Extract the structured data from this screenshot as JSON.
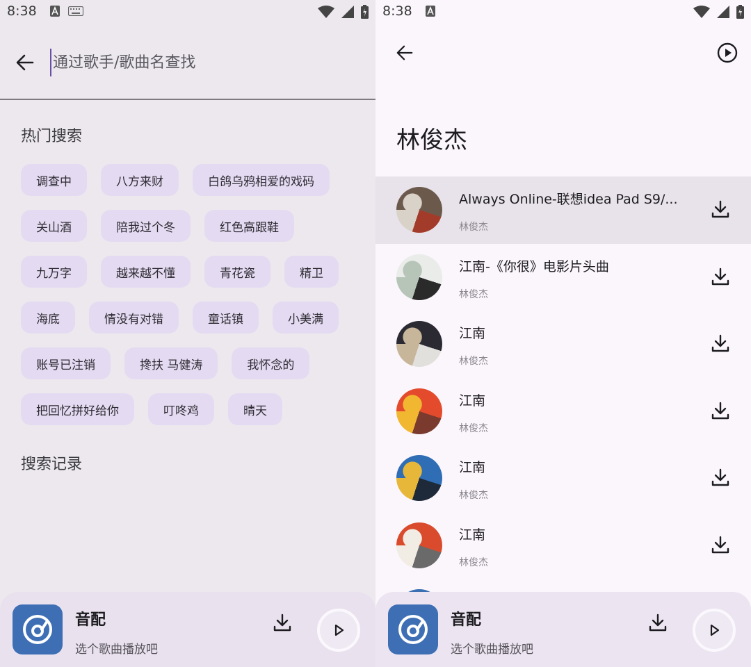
{
  "left": {
    "status": {
      "time": "8:38"
    },
    "search": {
      "placeholder": "通过歌手/歌曲名查找"
    },
    "hot_title": "热门搜索",
    "hot_searches": [
      "调查中",
      "八方来财",
      "白鸽乌鸦相爱的戏码",
      "关山酒",
      "陪我过个冬",
      "红色高跟鞋",
      "九万字",
      "越来越不懂",
      "青花瓷",
      "精卫",
      "海底",
      "情没有对错",
      "童话镇",
      "小美满",
      "账号已注销",
      "搀扶  马健涛",
      "我怀念的",
      "把回忆拼好给你",
      "叮咚鸡",
      "晴天"
    ],
    "history_title": "搜索记录",
    "player": {
      "title": "音配",
      "subtitle": "选个歌曲播放吧"
    }
  },
  "right": {
    "status": {
      "time": "8:38"
    },
    "artist": "林俊杰",
    "songs": [
      {
        "title": "Always Online-联想idea Pad S9/...",
        "artist": "林俊杰",
        "active": true,
        "cover": [
          "#6b5a4c",
          "#d9d2c8",
          "#a33b2a"
        ]
      },
      {
        "title": "江南-《你很》电影片头曲",
        "artist": "林俊杰",
        "active": false,
        "cover": [
          "#e9ece9",
          "#b7c4b8",
          "#2a2a2a"
        ]
      },
      {
        "title": "江南",
        "artist": "林俊杰",
        "active": false,
        "cover": [
          "#2b2a33",
          "#c8b69a",
          "#e2e0dc"
        ]
      },
      {
        "title": "江南",
        "artist": "林俊杰",
        "active": false,
        "cover": [
          "#e44a2c",
          "#f2b731",
          "#7a3b2e"
        ]
      },
      {
        "title": "江南",
        "artist": "林俊杰",
        "active": false,
        "cover": [
          "#2f6db4",
          "#e7b73a",
          "#1e2a3a"
        ]
      },
      {
        "title": "江南",
        "artist": "林俊杰",
        "active": false,
        "cover": [
          "#d94b2c",
          "#f1ece4",
          "#6a6a6a"
        ]
      },
      {
        "title": "",
        "artist": "",
        "active": false,
        "cover": [
          "#3a6fb2",
          "#e0c050",
          "#222"
        ]
      }
    ],
    "player": {
      "title": "音配",
      "subtitle": "选个歌曲播放吧"
    }
  }
}
